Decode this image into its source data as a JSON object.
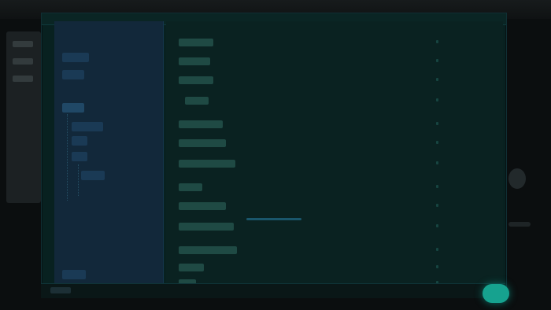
{
  "window": {
    "title": ""
  },
  "sidebar": {
    "items": [
      {
        "label": ""
      },
      {
        "label": ""
      },
      {
        "label": ""
      },
      {
        "label": ""
      },
      {
        "label": ""
      },
      {
        "label": ""
      },
      {
        "label": ""
      },
      {
        "label": ""
      }
    ]
  },
  "list": {
    "rows": [
      {
        "label": ""
      },
      {
        "label": ""
      },
      {
        "label": ""
      },
      {
        "label": ""
      },
      {
        "label": ""
      },
      {
        "label": ""
      },
      {
        "label": ""
      },
      {
        "label": ""
      },
      {
        "label": ""
      },
      {
        "label": ""
      },
      {
        "label": ""
      },
      {
        "label": ""
      },
      {
        "label": ""
      }
    ]
  },
  "footer": {
    "ok_label": ""
  },
  "colors": {
    "panel_bg": "#082120",
    "sidebar_bg": "#12283a",
    "accent": "#16a28f"
  }
}
